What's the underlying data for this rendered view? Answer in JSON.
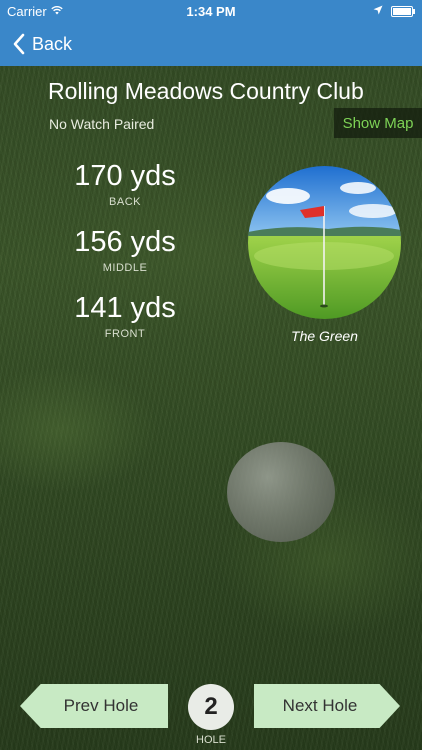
{
  "status_bar": {
    "carrier": "Carrier",
    "time": "1:34 PM",
    "icons": [
      "wifi-icon",
      "location-arrow-icon",
      "battery-icon"
    ]
  },
  "nav": {
    "back_label": "Back",
    "bar_color": "#3a87c9"
  },
  "course": {
    "name": "Rolling Meadows Country Club",
    "watch_status": "No Watch Paired",
    "show_map_label": "Show Map"
  },
  "distances": [
    {
      "value": "170 yds",
      "label": "BACK"
    },
    {
      "value": "156 yds",
      "label": "MIDDLE"
    },
    {
      "value": "141 yds",
      "label": "FRONT"
    }
  ],
  "green": {
    "caption": "The Green"
  },
  "hole": {
    "number": "2",
    "label": "HOLE",
    "prev_label": "Prev Hole",
    "next_label": "Next Hole"
  },
  "colors": {
    "accent_green": "#7ed356",
    "button_green": "#c8eac4"
  }
}
